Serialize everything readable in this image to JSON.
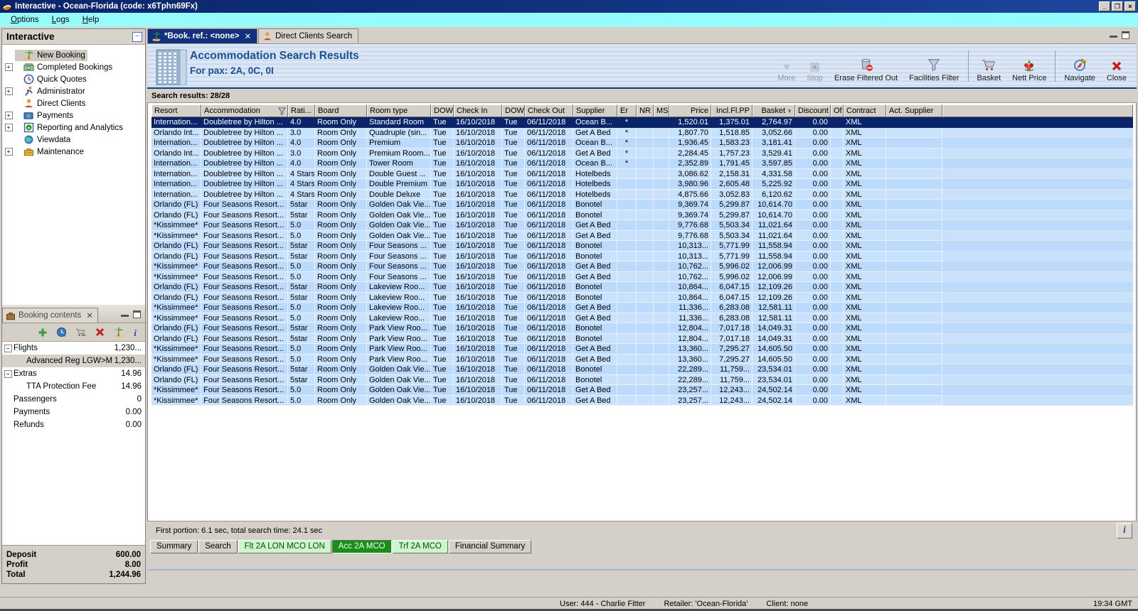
{
  "window": {
    "title": "Interactive - Ocean-Florida (code: x6Tphn69Fx)"
  },
  "menu": {
    "items": [
      "Options",
      "Logs",
      "Help"
    ]
  },
  "sidebar": {
    "title": "Interactive",
    "items": [
      {
        "label": "New Booking",
        "icon": "palm-tree-icon",
        "expandable": false,
        "selected": true
      },
      {
        "label": "Completed Bookings",
        "icon": "money-icon",
        "expandable": true,
        "selected": false
      },
      {
        "label": "Quick Quotes",
        "icon": "clock-icon",
        "expandable": false,
        "selected": false
      },
      {
        "label": "Administrator",
        "icon": "runner-icon",
        "expandable": true,
        "selected": false
      },
      {
        "label": "Direct Clients",
        "icon": "person-icon",
        "expandable": false,
        "selected": false
      },
      {
        "label": "Payments",
        "icon": "payments-icon",
        "expandable": true,
        "selected": false
      },
      {
        "label": "Reporting and Analytics",
        "icon": "report-icon",
        "expandable": true,
        "selected": false
      },
      {
        "label": "Viewdata",
        "icon": "globe-icon",
        "expandable": false,
        "selected": false
      },
      {
        "label": "Maintenance",
        "icon": "toolbox-icon",
        "expandable": true,
        "selected": false
      }
    ]
  },
  "booking_contents": {
    "title": "Booking contents",
    "toolbar_icons": [
      "add-icon",
      "availability-icon",
      "cart-go-icon",
      "delete-icon",
      "palm-tree-icon",
      "info-icon"
    ],
    "rows": [
      {
        "label": "Flights",
        "value": "1,230...",
        "indent": 0,
        "expander": true,
        "selected": false
      },
      {
        "label": "Advanced Reg LGW>M",
        "value": "1,230...",
        "indent": 1,
        "expander": false,
        "selected": true
      },
      {
        "label": "Extras",
        "value": "14.96",
        "indent": 0,
        "expander": true,
        "selected": false
      },
      {
        "label": "TTA Protection Fee",
        "value": "14.96",
        "indent": 1,
        "expander": false,
        "selected": false
      },
      {
        "label": "Passengers",
        "value": "0",
        "indent": 0,
        "expander": false,
        "selected": false
      },
      {
        "label": "Payments",
        "value": "0.00",
        "indent": 0,
        "expander": false,
        "selected": false
      },
      {
        "label": "Refunds",
        "value": "0.00",
        "indent": 0,
        "expander": false,
        "selected": false
      }
    ],
    "summary": [
      {
        "label": "Deposit",
        "value": "600.00"
      },
      {
        "label": "Profit",
        "value": "8.00"
      },
      {
        "label": "Total",
        "value": "1,244.96"
      }
    ]
  },
  "tabs": [
    {
      "label": "*Book. ref.: <none>",
      "icon": "palm-tree-icon",
      "active": true,
      "closable": true
    },
    {
      "label": "Direct Clients Search",
      "icon": "person-icon",
      "active": false,
      "closable": false
    }
  ],
  "header": {
    "title": "Accommodation Search Results",
    "subtitle": "For pax: 2A, 0C, 0I"
  },
  "toolbar": {
    "groups": [
      [
        {
          "label": "More",
          "icon": "more-icon",
          "disabled": true
        },
        {
          "label": "Stop",
          "icon": "stop-icon",
          "disabled": true
        },
        {
          "label": "Erase Filtered Out",
          "icon": "erase-filter-icon",
          "disabled": false
        },
        {
          "label": "Facilities Filter",
          "icon": "funnel-icon",
          "disabled": false
        }
      ],
      [
        {
          "label": "Basket",
          "icon": "basket-icon",
          "disabled": false
        },
        {
          "label": "Nett Price",
          "icon": "nett-price-icon",
          "disabled": false
        }
      ],
      [
        {
          "label": "Navigate",
          "icon": "compass-icon",
          "disabled": false
        },
        {
          "label": "Close",
          "icon": "close-red-icon",
          "disabled": false
        }
      ]
    ]
  },
  "results": {
    "count_label": "Search results: 28/28",
    "columns": [
      "Resort",
      "Accommodation",
      "Rati...",
      "Board",
      "Room type",
      "DOW",
      "Check In",
      "DOW",
      "Check Out",
      "Supplier",
      "Er",
      "NR",
      "MS",
      "Price",
      "Incl.Fl.PP",
      "Basket",
      "Discount",
      "Of",
      "Contract",
      "Act. Supplier"
    ],
    "selected_row": 0,
    "rows": [
      [
        "Internation...",
        "Doubletree by Hilton ...",
        "4.0",
        "Room Only",
        "Standard Room",
        "Tue",
        "16/10/2018",
        "Tue",
        "06/11/2018",
        "Ocean B...",
        "*",
        "",
        "",
        "1,520.01",
        "1,375.01",
        "2,764.97",
        "0.00",
        "",
        "XML",
        ""
      ],
      [
        "Orlando Int...",
        "Doubletree by Hilton ...",
        "3.0",
        "Room Only",
        "Quadruple (sin...",
        "Tue",
        "16/10/2018",
        "Tue",
        "06/11/2018",
        "Get A Bed",
        "*",
        "",
        "",
        "1,807.70",
        "1,518.85",
        "3,052.66",
        "0.00",
        "",
        "XML",
        ""
      ],
      [
        "Internation...",
        "Doubletree by Hilton ...",
        "4.0",
        "Room Only",
        "Premium",
        "Tue",
        "16/10/2018",
        "Tue",
        "06/11/2018",
        "Ocean B...",
        "*",
        "",
        "",
        "1,936.45",
        "1,583.23",
        "3,181.41",
        "0.00",
        "",
        "XML",
        ""
      ],
      [
        "Orlando Int...",
        "Doubletree by Hilton ...",
        "3.0",
        "Room Only",
        "Premium Room...",
        "Tue",
        "16/10/2018",
        "Tue",
        "06/11/2018",
        "Get A Bed",
        "*",
        "",
        "",
        "2,284.45",
        "1,757.23",
        "3,529.41",
        "0.00",
        "",
        "XML",
        ""
      ],
      [
        "Internation...",
        "Doubletree by Hilton ...",
        "4.0",
        "Room Only",
        "Tower Room",
        "Tue",
        "16/10/2018",
        "Tue",
        "06/11/2018",
        "Ocean B...",
        "*",
        "",
        "",
        "2,352.89",
        "1,791.45",
        "3,597.85",
        "0.00",
        "",
        "XML",
        ""
      ],
      [
        "Internation...",
        "Doubletree by Hilton ...",
        "4 Stars",
        "Room Only",
        "Double Guest ...",
        "Tue",
        "16/10/2018",
        "Tue",
        "06/11/2018",
        "Hotelbeds",
        "",
        "",
        "",
        "3,086.62",
        "2,158.31",
        "4,331.58",
        "0.00",
        "",
        "XML",
        ""
      ],
      [
        "Internation...",
        "Doubletree by Hilton ...",
        "4 Stars",
        "Room Only",
        "Double Premium",
        "Tue",
        "16/10/2018",
        "Tue",
        "06/11/2018",
        "Hotelbeds",
        "",
        "",
        "",
        "3,980.96",
        "2,605.48",
        "5,225.92",
        "0.00",
        "",
        "XML",
        ""
      ],
      [
        "Internation...",
        "Doubletree by Hilton ...",
        "4 Stars",
        "Room Only",
        "Double Deluxe",
        "Tue",
        "16/10/2018",
        "Tue",
        "06/11/2018",
        "Hotelbeds",
        "",
        "",
        "",
        "4,875.66",
        "3,052.83",
        "6,120.62",
        "0.00",
        "",
        "XML",
        ""
      ],
      [
        "Orlando (FL)",
        "Four Seasons Resort...",
        "5star",
        "Room Only",
        "Golden Oak Vie...",
        "Tue",
        "16/10/2018",
        "Tue",
        "06/11/2018",
        "Bonotel",
        "",
        "",
        "",
        "9,369.74",
        "5,299.87",
        "10,614.70",
        "0.00",
        "",
        "XML",
        ""
      ],
      [
        "Orlando (FL)",
        "Four Seasons Resort...",
        "5star",
        "Room Only",
        "Golden Oak Vie...",
        "Tue",
        "16/10/2018",
        "Tue",
        "06/11/2018",
        "Bonotel",
        "",
        "",
        "",
        "9,369.74",
        "5,299.87",
        "10,614.70",
        "0.00",
        "",
        "XML",
        ""
      ],
      [
        "*Kissimmee*",
        "Four Seasons Resort...",
        "5.0",
        "Room Only",
        "Golden Oak Vie...",
        "Tue",
        "16/10/2018",
        "Tue",
        "06/11/2018",
        "Get A Bed",
        "",
        "",
        "",
        "9,776.68",
        "5,503.34",
        "11,021.64",
        "0.00",
        "",
        "XML",
        ""
      ],
      [
        "*Kissimmee*",
        "Four Seasons Resort...",
        "5.0",
        "Room Only",
        "Golden Oak Vie...",
        "Tue",
        "16/10/2018",
        "Tue",
        "06/11/2018",
        "Get A Bed",
        "",
        "",
        "",
        "9,776.68",
        "5,503.34",
        "11,021.64",
        "0.00",
        "",
        "XML",
        ""
      ],
      [
        "Orlando (FL)",
        "Four Seasons Resort...",
        "5star",
        "Room Only",
        "Four Seasons ...",
        "Tue",
        "16/10/2018",
        "Tue",
        "06/11/2018",
        "Bonotel",
        "",
        "",
        "",
        "10,313...",
        "5,771.99",
        "11,558.94",
        "0.00",
        "",
        "XML",
        ""
      ],
      [
        "Orlando (FL)",
        "Four Seasons Resort...",
        "5star",
        "Room Only",
        "Four Seasons ...",
        "Tue",
        "16/10/2018",
        "Tue",
        "06/11/2018",
        "Bonotel",
        "",
        "",
        "",
        "10,313...",
        "5,771.99",
        "11,558.94",
        "0.00",
        "",
        "XML",
        ""
      ],
      [
        "*Kissimmee*",
        "Four Seasons Resort...",
        "5.0",
        "Room Only",
        "Four Seasons ...",
        "Tue",
        "16/10/2018",
        "Tue",
        "06/11/2018",
        "Get A Bed",
        "",
        "",
        "",
        "10,762...",
        "5,996.02",
        "12,006.99",
        "0.00",
        "",
        "XML",
        ""
      ],
      [
        "*Kissimmee*",
        "Four Seasons Resort...",
        "5.0",
        "Room Only",
        "Four Seasons ...",
        "Tue",
        "16/10/2018",
        "Tue",
        "06/11/2018",
        "Get A Bed",
        "",
        "",
        "",
        "10,762...",
        "5,996.02",
        "12,006.99",
        "0.00",
        "",
        "XML",
        ""
      ],
      [
        "Orlando (FL)",
        "Four Seasons Resort...",
        "5star",
        "Room Only",
        "Lakeview Roo...",
        "Tue",
        "16/10/2018",
        "Tue",
        "06/11/2018",
        "Bonotel",
        "",
        "",
        "",
        "10,864...",
        "6,047.15",
        "12,109.26",
        "0.00",
        "",
        "XML",
        ""
      ],
      [
        "Orlando (FL)",
        "Four Seasons Resort...",
        "5star",
        "Room Only",
        "Lakeview Roo...",
        "Tue",
        "16/10/2018",
        "Tue",
        "06/11/2018",
        "Bonotel",
        "",
        "",
        "",
        "10,864...",
        "6,047.15",
        "12,109.26",
        "0.00",
        "",
        "XML",
        ""
      ],
      [
        "*Kissimmee*",
        "Four Seasons Resort...",
        "5.0",
        "Room Only",
        "Lakeview Roo...",
        "Tue",
        "16/10/2018",
        "Tue",
        "06/11/2018",
        "Get A Bed",
        "",
        "",
        "",
        "11,336...",
        "6,283.08",
        "12,581.11",
        "0.00",
        "",
        "XML",
        ""
      ],
      [
        "*Kissimmee*",
        "Four Seasons Resort...",
        "5.0",
        "Room Only",
        "Lakeview Roo...",
        "Tue",
        "16/10/2018",
        "Tue",
        "06/11/2018",
        "Get A Bed",
        "",
        "",
        "",
        "11,336...",
        "6,283.08",
        "12,581.11",
        "0.00",
        "",
        "XML",
        ""
      ],
      [
        "Orlando (FL)",
        "Four Seasons Resort...",
        "5star",
        "Room Only",
        "Park View Roo...",
        "Tue",
        "16/10/2018",
        "Tue",
        "06/11/2018",
        "Bonotel",
        "",
        "",
        "",
        "12,804...",
        "7,017.18",
        "14,049.31",
        "0.00",
        "",
        "XML",
        ""
      ],
      [
        "Orlando (FL)",
        "Four Seasons Resort...",
        "5star",
        "Room Only",
        "Park View Roo...",
        "Tue",
        "16/10/2018",
        "Tue",
        "06/11/2018",
        "Bonotel",
        "",
        "",
        "",
        "12,804...",
        "7,017.18",
        "14,049.31",
        "0.00",
        "",
        "XML",
        ""
      ],
      [
        "*Kissimmee*",
        "Four Seasons Resort...",
        "5.0",
        "Room Only",
        "Park View Roo...",
        "Tue",
        "16/10/2018",
        "Tue",
        "06/11/2018",
        "Get A Bed",
        "",
        "",
        "",
        "13,360...",
        "7,295.27",
        "14,605.50",
        "0.00",
        "",
        "XML",
        ""
      ],
      [
        "*Kissimmee*",
        "Four Seasons Resort...",
        "5.0",
        "Room Only",
        "Park View Roo...",
        "Tue",
        "16/10/2018",
        "Tue",
        "06/11/2018",
        "Get A Bed",
        "",
        "",
        "",
        "13,360...",
        "7,295.27",
        "14,605.50",
        "0.00",
        "",
        "XML",
        ""
      ],
      [
        "Orlando (FL)",
        "Four Seasons Resort...",
        "5star",
        "Room Only",
        "Golden Oak Vie...",
        "Tue",
        "16/10/2018",
        "Tue",
        "06/11/2018",
        "Bonotel",
        "",
        "",
        "",
        "22,289...",
        "11,759...",
        "23,534.01",
        "0.00",
        "",
        "XML",
        ""
      ],
      [
        "Orlando (FL)",
        "Four Seasons Resort...",
        "5star",
        "Room Only",
        "Golden Oak Vie...",
        "Tue",
        "16/10/2018",
        "Tue",
        "06/11/2018",
        "Bonotel",
        "",
        "",
        "",
        "22,289...",
        "11,759...",
        "23,534.01",
        "0.00",
        "",
        "XML",
        ""
      ],
      [
        "*Kissimmee*",
        "Four Seasons Resort...",
        "5.0",
        "Room Only",
        "Golden Oak Vie...",
        "Tue",
        "16/10/2018",
        "Tue",
        "06/11/2018",
        "Get A Bed",
        "",
        "",
        "",
        "23,257...",
        "12,243...",
        "24,502.14",
        "0.00",
        "",
        "XML",
        ""
      ],
      [
        "*Kissimmee*",
        "Four Seasons Resort...",
        "5.0",
        "Room Only",
        "Golden Oak Vie...",
        "Tue",
        "16/10/2018",
        "Tue",
        "06/11/2018",
        "Get A Bed",
        "",
        "",
        "",
        "23,257...",
        "12,243...",
        "24,502.14",
        "0.00",
        "",
        "XML",
        ""
      ]
    ]
  },
  "footer": {
    "timing": "First portion: 6.1 sec, total search time: 24.1 sec",
    "tabs": [
      {
        "label": "Summary",
        "style": "plain"
      },
      {
        "label": "Search",
        "style": "plain"
      },
      {
        "label": "Flt 2A LON MCO LON",
        "style": "green"
      },
      {
        "label": "Acc 2A MCO",
        "style": "activegreen"
      },
      {
        "label": "Trf 2A MCO",
        "style": "green"
      },
      {
        "label": "Financial Summary",
        "style": "plain"
      }
    ]
  },
  "statusbar": {
    "user": "User: 444 - Charlie Fitter",
    "retailer": "Retailer: 'Ocean-Florida'",
    "client": "Client: none",
    "time": "19:34 GMT"
  }
}
